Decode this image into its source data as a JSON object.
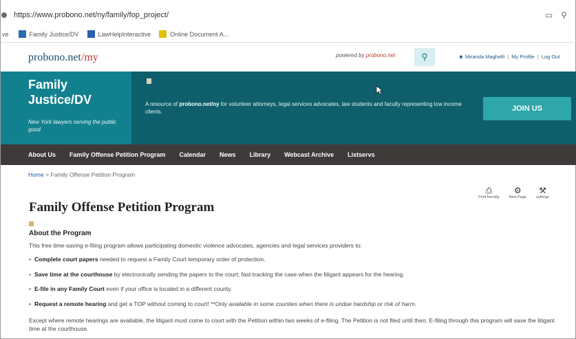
{
  "browser": {
    "url": "https://www.probono.net/ny/family/fop_project/",
    "bookmarks": [
      {
        "label": "ve",
        "color": "#555555"
      },
      {
        "label": "Family Justice/DV",
        "color": "#2b6cb0"
      },
      {
        "label": "LawHelpInteractive",
        "color": "#2b5fb0"
      },
      {
        "label": "Online Document A...",
        "color": "#e0c200"
      }
    ]
  },
  "site": {
    "logo_main": "probono.net",
    "logo_suffix": "/my",
    "powered_by_prefix": "powered by",
    "powered_by_brand": "probono.net",
    "account_user": "Miranda Maghelli",
    "account_profile": "My Profile",
    "account_logout": "Log Out"
  },
  "banner": {
    "title_line1": "Family",
    "title_line2": "Justice/DV",
    "tagline": "New York lawyers serving the public good",
    "desc_prefix": "A resource of",
    "desc_brand": "probono.net/ny",
    "desc_rest": "for volunteer attorneys, legal services advocates, law students and faculty representing low income clients.",
    "join_label": "JOIN US"
  },
  "nav": [
    "About Us",
    "Family Offense Petition Program",
    "Calendar",
    "News",
    "Library",
    "Webcast Archive",
    "Listservs"
  ],
  "breadcrumb": {
    "home": "Home",
    "separator": ">",
    "current": "Family Offense Petition Program"
  },
  "page_tools": [
    {
      "label": "Print friendly",
      "icon": "printer-icon"
    },
    {
      "label": "New Page",
      "icon": "gear-icon"
    },
    {
      "label": "settings",
      "icon": "tools-icon"
    }
  ],
  "content": {
    "title": "Family Offense Petition Program",
    "subtitle": "About the Program",
    "intro": "This free time-saving e-filing program allows participating domestic violence advocates, agencies and legal services providers to:",
    "bullets": [
      {
        "bold": "Complete court papers",
        "rest": "needed to request a Family Court temporary order of protection.",
        "italic": ""
      },
      {
        "bold": "Save time at the courthouse",
        "rest": "by electronically sending the papers to the court; fast-tracking the case when the litigant appears for the hearing.",
        "italic": ""
      },
      {
        "bold": "E-file in any Family Court",
        "rest": "even if your office is located in a different county.",
        "italic": ""
      },
      {
        "bold": "Request a remote hearing",
        "rest": "and get a TOP without coming to court! **Only",
        "italic": "available in some counties when there is undue hardship or risk of harm."
      }
    ],
    "outro": "Except where remote hearings are available, the litigant must come to court with the Petition within two weeks of e-filing. The Petition is not filed until then. E-filing through this program will save the litigant time at the courthouse."
  },
  "colors": {
    "banner_dark": "#0e5f6b",
    "banner_light": "#12818f",
    "join_button": "#2ea6aa",
    "nav_bg": "#3f3a3a",
    "link": "#1d5a99"
  }
}
